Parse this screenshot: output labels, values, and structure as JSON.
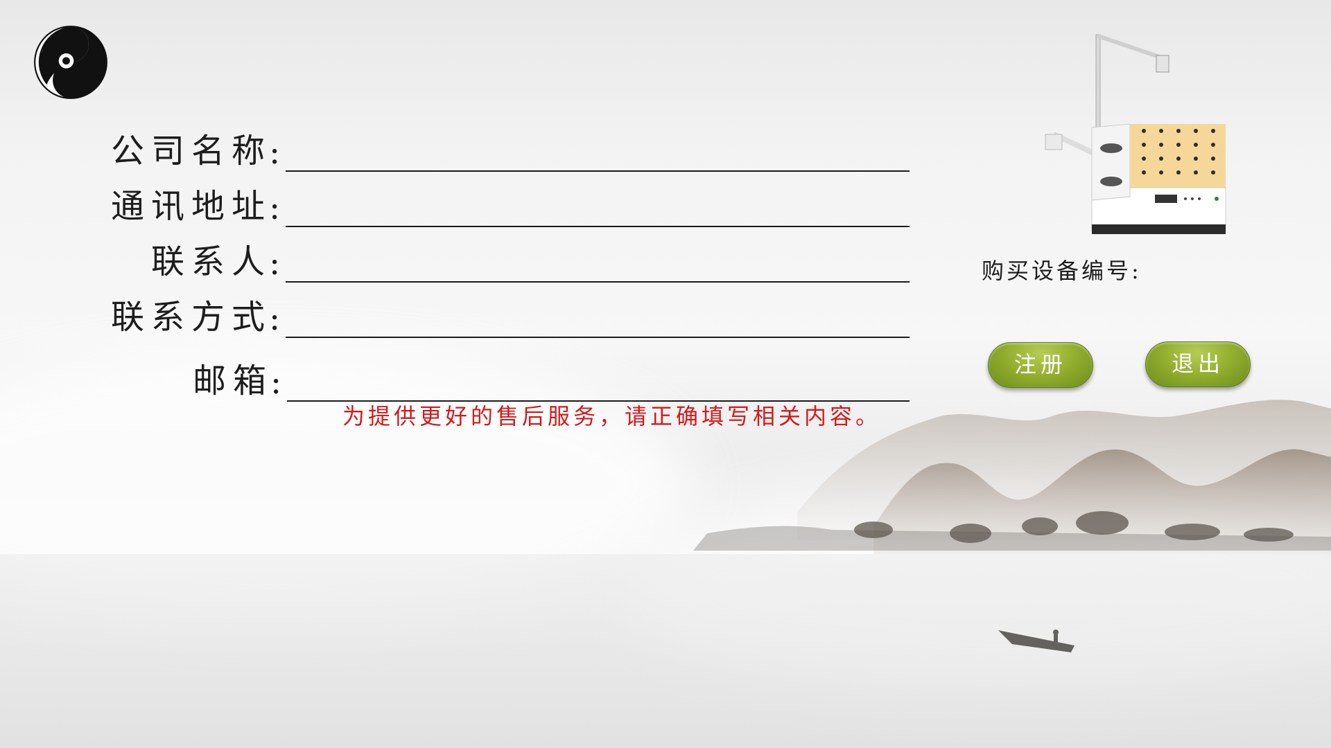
{
  "form": {
    "company_name_label": "公司名称",
    "address_label": "通讯地址",
    "contact_person_label": "联系人",
    "contact_method_label": "联系方式",
    "email_label": "邮箱",
    "colon": ":",
    "company_name_value": "",
    "address_value": "",
    "contact_person_value": "",
    "contact_method_value": "",
    "email_value": ""
  },
  "notice": "为提供更好的售后服务，请正确填写相关内容。",
  "device": {
    "serial_label": "购买设备编号:"
  },
  "buttons": {
    "register_label": "注册",
    "exit_label": "退出"
  },
  "colors": {
    "notice": "#d21a1a",
    "button_green": "#93b02f",
    "text": "#1d1d1d"
  },
  "icons": [
    "yin-yang-logo-icon",
    "device-product-image"
  ]
}
